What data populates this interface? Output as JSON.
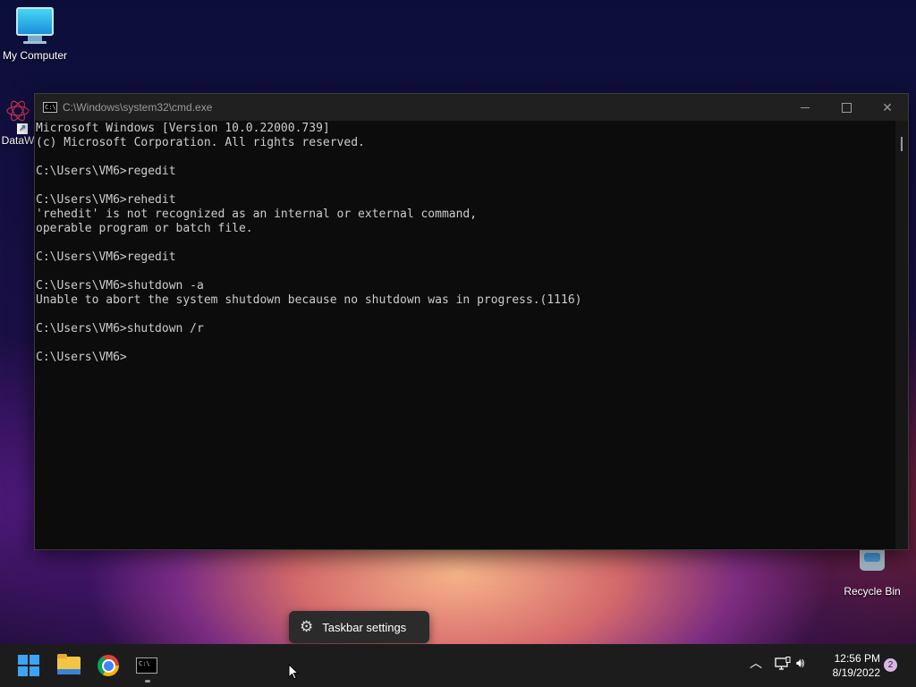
{
  "desktop": {
    "icons": [
      {
        "label": "My Computer"
      },
      {
        "label": "DataW"
      },
      {
        "label": "Recycle Bin"
      }
    ]
  },
  "cmd": {
    "title": "C:\\Windows\\system32\\cmd.exe",
    "lines": [
      "Microsoft Windows [Version 10.0.22000.739]",
      "(c) Microsoft Corporation. All rights reserved.",
      "",
      "C:\\Users\\VM6>regedit",
      "",
      "C:\\Users\\VM6>rehedit",
      "'rehedit' is not recognized as an internal or external command,",
      "operable program or batch file.",
      "",
      "C:\\Users\\VM6>regedit",
      "",
      "C:\\Users\\VM6>shutdown -a",
      "Unable to abort the system shutdown because no shutdown was in progress.(1116)",
      "",
      "C:\\Users\\VM6>shutdown /r",
      "",
      "C:\\Users\\VM6>"
    ]
  },
  "tooltip": {
    "label": "Taskbar settings",
    "icon": "gear-icon"
  },
  "taskbar": {
    "items": [
      {
        "name": "start",
        "icon": "windows-logo-icon"
      },
      {
        "name": "file-explorer",
        "icon": "folder-icon"
      },
      {
        "name": "chrome",
        "icon": "chrome-icon"
      },
      {
        "name": "command-prompt",
        "icon": "cmd-icon"
      }
    ],
    "tray": {
      "time": "12:56 PM",
      "date": "8/19/2022",
      "notification_count": "2"
    }
  },
  "colors": {
    "console_bg": "#0c0c0c",
    "console_text": "#cccccc",
    "titlebar": "#202020",
    "taskbar": "#1c1c1c",
    "accent": "#3ba4f5"
  }
}
